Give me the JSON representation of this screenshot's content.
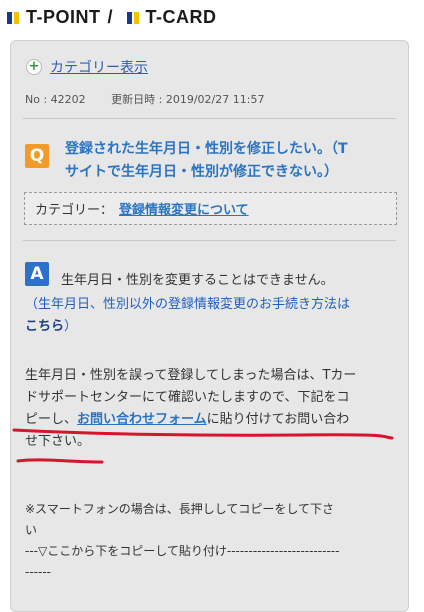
{
  "header": {
    "logo_left": "T-POINT",
    "separator": "/",
    "logo_right": "T-CARD"
  },
  "category_toggle": {
    "icon": "plus-icon",
    "label": "カテゴリー表示"
  },
  "meta": {
    "number": "No : 42202",
    "updated": "更新日時 : 2019/02/27 11:57"
  },
  "question": {
    "icon_letter": "Q",
    "line1": "登録された生年月日・性別を修正したい。（T",
    "line2": "サイトで生年月日・性別が修正できない。）"
  },
  "category_box": {
    "label": "カテゴリー：",
    "value": "登録情報変更について"
  },
  "answer": {
    "icon_letter": "A",
    "text": "生年月日・性別を変更することはできません。",
    "note_line1": "（生年月日、性別以外の登録情報変更のお手続き方法は",
    "note_link": "こちら",
    "note_close": "）"
  },
  "body1": {
    "line1": "生年月日・性別を誤って登録してしまった場合は、Tカー",
    "line2": "ドサポートセンターにて確認いたしますので、下記をコ",
    "line3_pre": "ピーし、",
    "line3_link": "お問い合わせフォーム",
    "line3_post": "に貼り付けてお問い合わ",
    "line4": "せ下さい。"
  },
  "body2": {
    "line1": "※スマートフォンの場合は、長押ししてコピーをして下さ",
    "line2": "い",
    "line3": "---▽ここから下をコピーして貼り付け--------------------------",
    "line4": "------"
  },
  "colors": {
    "accent_blue": "#2a74c2",
    "q_orange": "#f39a2a",
    "a_blue": "#2d72c7",
    "annotation_red": "#d6162c"
  }
}
